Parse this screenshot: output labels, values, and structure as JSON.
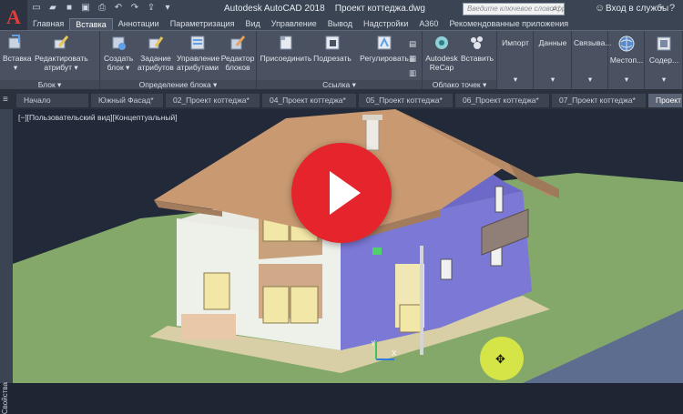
{
  "window": {
    "app_name": "Autodesk AutoCAD 2018",
    "file_name": "Проект коттеджа.dwg",
    "logo_letter": "A",
    "search_placeholder": "Введите ключевое слово/фразу",
    "login_label": "Вход в службы",
    "help": "?"
  },
  "ribbon_tabs": [
    {
      "label": "Главная",
      "active": false
    },
    {
      "label": "Вставка",
      "active": true
    },
    {
      "label": "Аннотации",
      "active": false
    },
    {
      "label": "Параметризация",
      "active": false
    },
    {
      "label": "Вид",
      "active": false
    },
    {
      "label": "Управление",
      "active": false
    },
    {
      "label": "Вывод",
      "active": false
    },
    {
      "label": "Надстройки",
      "active": false
    },
    {
      "label": "A360",
      "active": false
    },
    {
      "label": "Рекомендованные приложения",
      "active": false
    }
  ],
  "ribbon": {
    "block_panel": {
      "title": "Блок ▾",
      "insert": "Вставка",
      "edit_attribute": [
        "Редактировать",
        "атрибут"
      ]
    },
    "block_def_panel": {
      "title": "Определение блока ▾",
      "create_block": [
        "Создать",
        "блок"
      ],
      "define_attributes": [
        "Задание",
        "атрибутов"
      ],
      "manage_attributes": [
        "Управление",
        "атрибутами"
      ],
      "block_editor": [
        "Редактор",
        "блоков"
      ]
    },
    "reference_panel": {
      "title": "Ссылка ▾",
      "attach": "Присоединить",
      "clip": "Подрезать",
      "adjust": "Регулировать"
    },
    "point_cloud_panel": {
      "title": "Облако точек ▾",
      "recap": [
        "Autodesk",
        "ReCap"
      ],
      "attach": "Вставить"
    },
    "import_panel": {
      "label": "Импорт"
    },
    "data_panel": {
      "label": "Данные"
    },
    "linking_panel": {
      "label": "Связыва..."
    },
    "location_panel": {
      "label": "Местоп..."
    },
    "content_panel": {
      "label": "Содер..."
    }
  },
  "document_tabs": [
    {
      "label": "Начало",
      "active": false
    },
    {
      "label": "Южный Фасад*",
      "active": false
    },
    {
      "label": "02_Проект коттеджа*",
      "active": false
    },
    {
      "label": "04_Проект коттеджа*",
      "active": false
    },
    {
      "label": "05_Проект коттеджа*",
      "active": false
    },
    {
      "label": "06_Проект коттеджа*",
      "active": false
    },
    {
      "label": "07_Проект коттеджа*",
      "active": false
    },
    {
      "label": "Проект котт...",
      "active": true
    }
  ],
  "viewport": {
    "view_controls": "[−][Пользовательский вид][Концептуальный]",
    "side_palette": "Свойства",
    "ucs_x": "X",
    "ucs_y": "Y"
  },
  "colors": {
    "accent_red": "#e5252b",
    "ribbon_bg": "#4a5262",
    "viewport_bg": "#222a3a",
    "ground_green": "#84a86a",
    "roof": "#c99a72"
  }
}
